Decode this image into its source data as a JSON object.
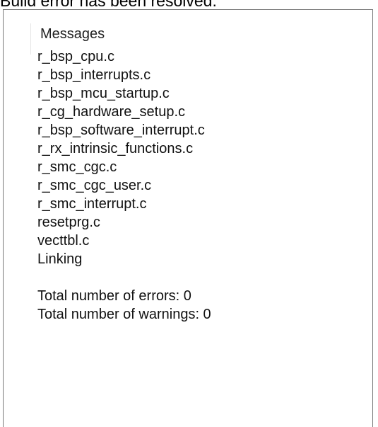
{
  "caption": "Build error has been resolved.",
  "panel": {
    "header": "Messages",
    "lines": [
      "r_bsp_cpu.c",
      "r_bsp_interrupts.c",
      "r_bsp_mcu_startup.c",
      "r_cg_hardware_setup.c",
      "r_bsp_software_interrupt.c",
      "r_rx_intrinsic_functions.c",
      "r_smc_cgc.c",
      "r_smc_cgc_user.c",
      "r_smc_interrupt.c",
      "resetprg.c",
      "vecttbl.c",
      "Linking"
    ],
    "summary": [
      "Total number of errors: 0",
      "Total number of warnings: 0"
    ]
  }
}
